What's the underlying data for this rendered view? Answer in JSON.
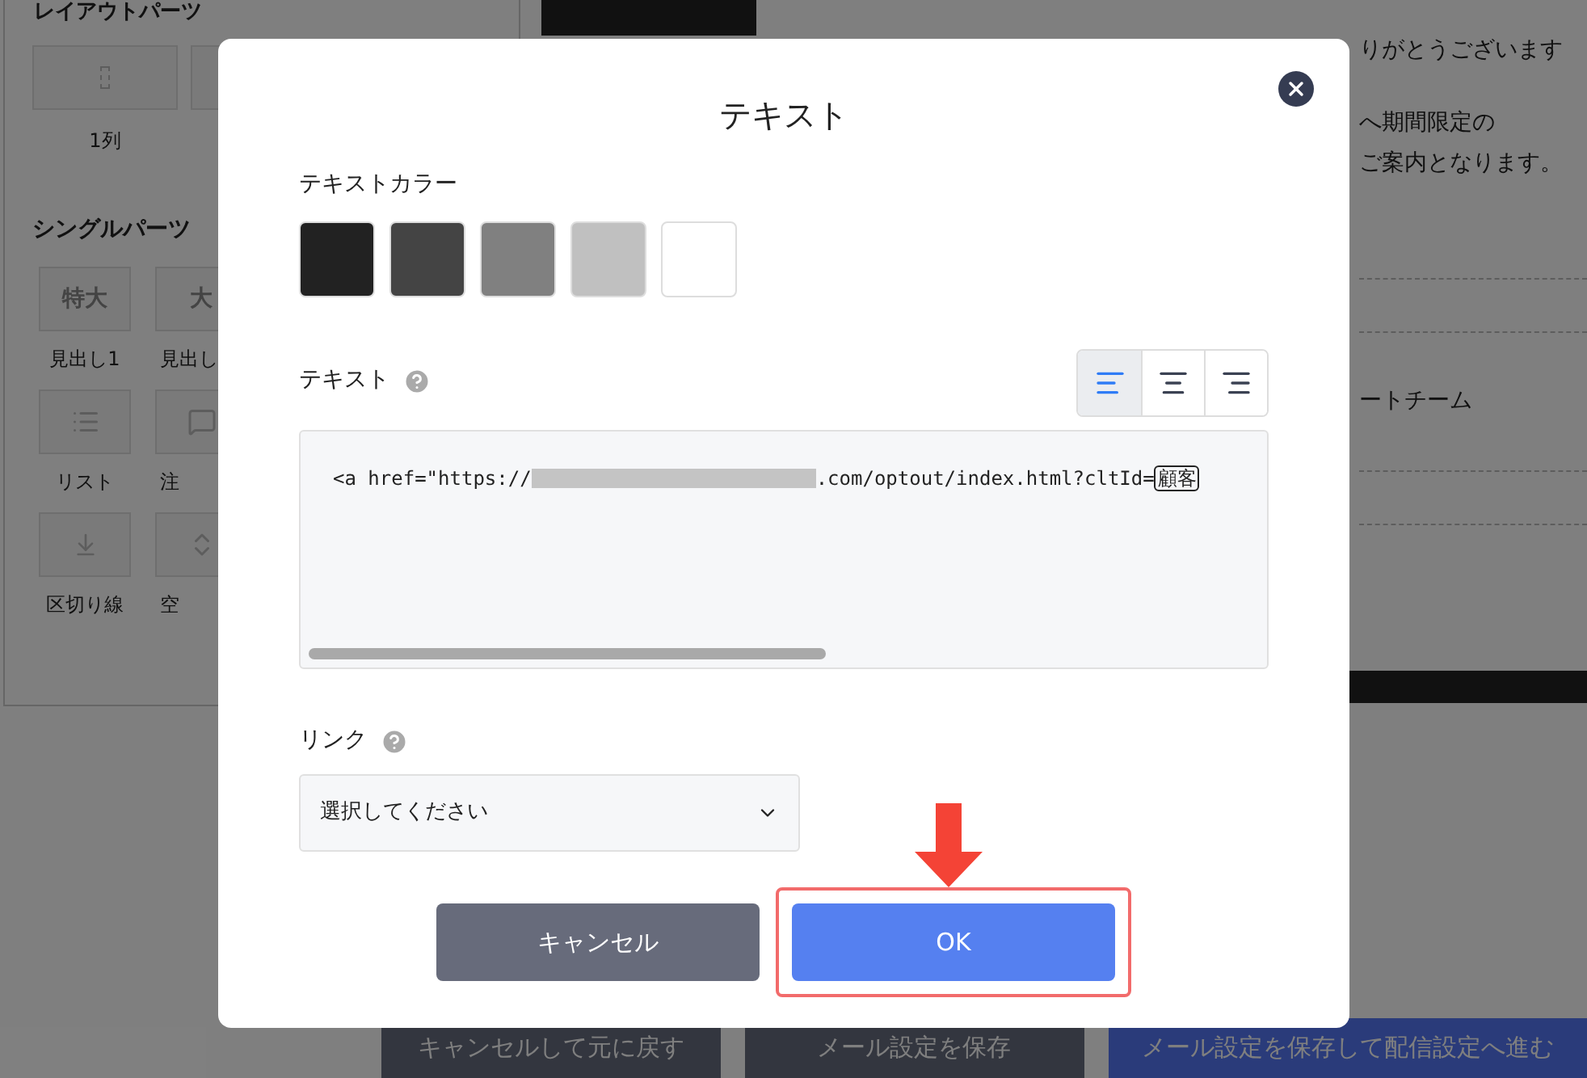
{
  "sidebar": {
    "layout_heading": "レイアウトパーツ",
    "layout_parts": [
      {
        "label": "1列",
        "kind": "column"
      },
      {
        "kind": "column"
      }
    ],
    "single_heading": "シングルパーツ",
    "single_parts": [
      {
        "label": "見出し1",
        "icon_text": "特大",
        "kind": "text"
      },
      {
        "label": "見出し",
        "icon_text": "大",
        "kind": "text"
      },
      {
        "label": "リスト",
        "kind": "list"
      },
      {
        "label": "注",
        "kind": "note"
      },
      {
        "label": "区切り線",
        "kind": "divider"
      },
      {
        "label": "空",
        "kind": "space"
      }
    ]
  },
  "preview": {
    "lines": [
      "りがとうございます",
      "へ期間限定の",
      "ご案内となります。",
      "ートチーム"
    ]
  },
  "footer_buttons": [
    {
      "label": "キャンセルして元に戻す",
      "kind": "secondary"
    },
    {
      "label": "メール設定を保存",
      "kind": "secondary"
    },
    {
      "label": "メール設定を保存して配信設定へ進む",
      "kind": "primary"
    }
  ],
  "dialog": {
    "title": "テキスト",
    "color_label": "テキストカラー",
    "colors": [
      {
        "color": "#222222"
      },
      {
        "color": "#444444"
      },
      {
        "color": "#808080"
      },
      {
        "color": "#c0c0c0"
      },
      {
        "color": "#ffffff"
      }
    ],
    "text_label": "テキスト",
    "alignments": [
      {
        "kind": "left",
        "selected": true
      },
      {
        "kind": "center",
        "selected": false
      },
      {
        "kind": "right",
        "selected": false
      }
    ],
    "code_prefix": "<a href=\"https://",
    "code_suffix": ".com/optout/index.html?cltId=",
    "code_tag": "顧客",
    "link_label": "リンク",
    "link_select": "選択してください",
    "cancel": "キャンセル",
    "ok": "OK",
    "ok_highlighted": true
  }
}
